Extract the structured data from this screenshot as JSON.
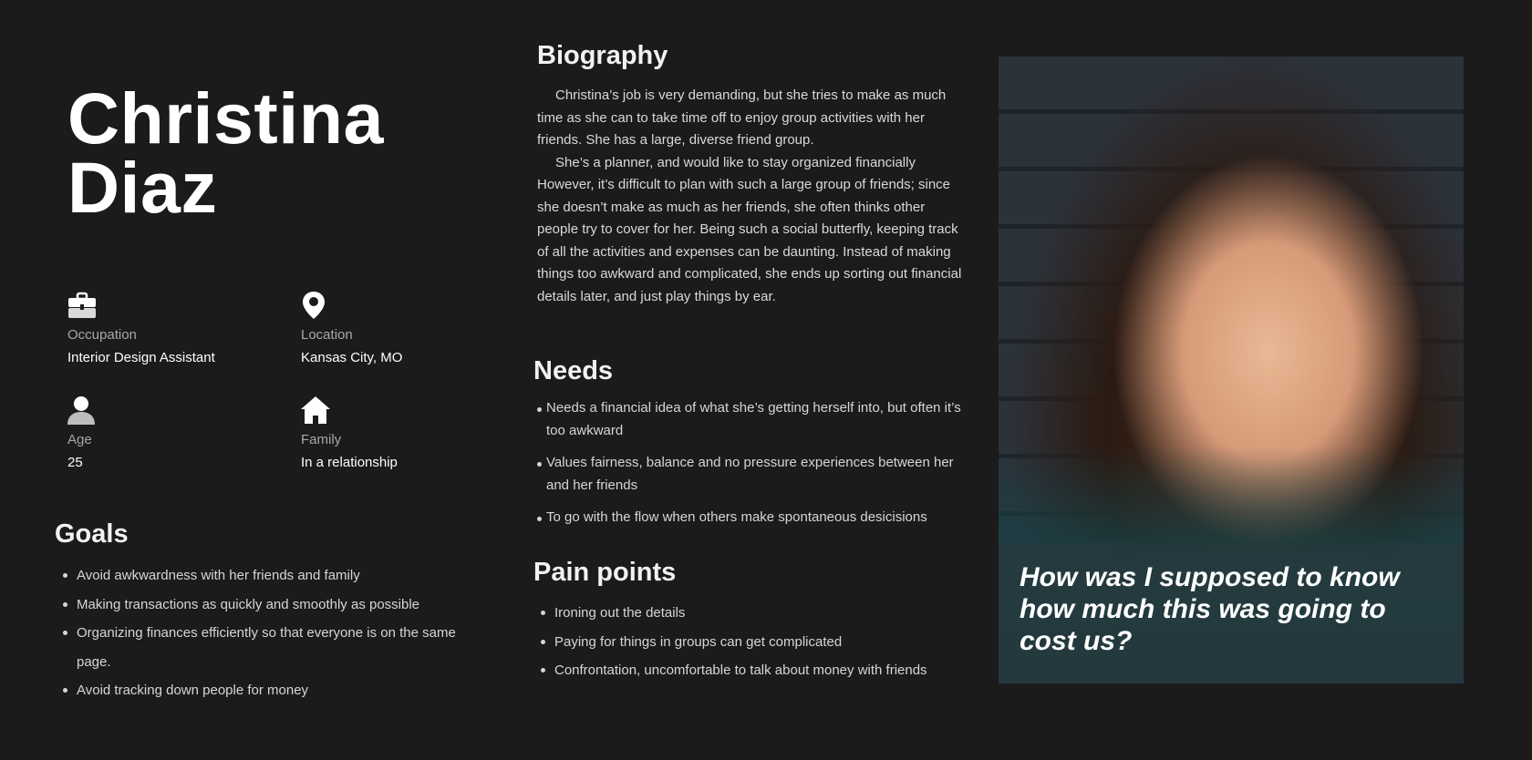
{
  "persona": {
    "first_name": "Christina",
    "last_name": "Diaz"
  },
  "facts": {
    "occupation": {
      "label": "Occupation",
      "value": "Interior Design Assistant",
      "icon": "briefcase-icon"
    },
    "location": {
      "label": "Location",
      "value": "Kansas City, MO",
      "icon": "map-pin-icon"
    },
    "age": {
      "label": "Age",
      "value": "25",
      "icon": "person-icon"
    },
    "family": {
      "label": "Family",
      "value": "In a relationship",
      "icon": "house-icon"
    }
  },
  "goals": {
    "title": "Goals",
    "items": [
      "Avoid awkwardness with her friends and family",
      "Making transactions as quickly and smoothly as possible",
      "Organizing finances efficiently so that everyone is on the same page.",
      "Avoid tracking down people for money"
    ]
  },
  "biography": {
    "title": "Biography",
    "paragraphs": [
      "Christina’s job is very demanding, but she tries to make as much time as she can to take time off to enjoy group activities with her friends. She has a large, diverse friend group.",
      "She’s a planner, and would like to stay organized financially However, it’s difficult to plan with such a large group of friends; since she doesn’t make as much as her friends, she often thinks other people try to cover for her. Being such a social butterfly, keeping track of all the activities and expenses can be daunting. Instead of making things too awkward and complicated, she ends up sorting out financial details later, and just play things by ear."
    ]
  },
  "needs": {
    "title": "Needs",
    "items": [
      "Needs a financial idea of what she’s getting herself into, but often it’s too awkward",
      "Values fairness, balance and no pressure experiences between her and her friends",
      "To go with the flow when others make spontaneous desicisions"
    ]
  },
  "pain_points": {
    "title": "Pain points",
    "items": [
      "Ironing out the details",
      "Paying for things in groups can get complicated",
      "Confrontation, uncomfortable to talk about money with friends"
    ]
  },
  "quote": "How was I supposed to know how much this was going to cost us?",
  "colors": {
    "background": "#1b1b1b",
    "text": "#e6e6e6",
    "muted_text": "#a8a8a8"
  }
}
